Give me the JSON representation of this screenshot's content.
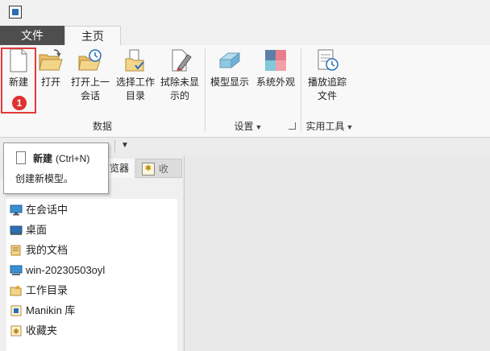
{
  "menu_tabs": [
    {
      "label": "文件",
      "active": false
    },
    {
      "label": "主页",
      "active": true
    }
  ],
  "ribbon": {
    "buttons": [
      {
        "name": "new",
        "label": "新建",
        "icon": "new-document-icon",
        "highlighted": true,
        "badge": "1"
      },
      {
        "name": "open",
        "label": "打开",
        "icon": "open-folder-icon"
      },
      {
        "name": "open-last-session",
        "label1": "打开上一",
        "label2": "会话",
        "icon": "last-session-icon"
      },
      {
        "name": "select-working-dir",
        "label1": "选择工作",
        "label2": "目录",
        "icon": "working-directory-icon"
      },
      {
        "name": "erase-not-displayed",
        "label1": "拭除未显",
        "label2": "示的",
        "icon": "erase-icon"
      },
      {
        "name": "model-display",
        "label": "模型显示",
        "icon": "model-display-icon"
      },
      {
        "name": "system-appearance",
        "label": "系统外观",
        "icon": "system-appearance-icon"
      },
      {
        "name": "play-trail-file",
        "label1": "播放追踪",
        "label2": "文件",
        "icon": "trail-file-icon"
      }
    ],
    "groups": [
      {
        "label": "数据"
      },
      {
        "label": "设置",
        "dropdown": true
      },
      {
        "label": "实用工具",
        "dropdown": true
      }
    ]
  },
  "panel_tabs": [
    {
      "label": "览器"
    },
    {
      "label": "收",
      "icon": "favorites-icon"
    }
  ],
  "tree_items": [
    {
      "label": "在会话中",
      "icon": "monitor-icon"
    },
    {
      "label": "桌面",
      "icon": "desktop-icon"
    },
    {
      "label": "我的文档",
      "icon": "documents-icon"
    },
    {
      "label": "win-20230503oyl",
      "icon": "computer-icon"
    },
    {
      "label": "工作目录",
      "icon": "working-directory-icon"
    },
    {
      "label": "Manikin 库",
      "icon": "library-icon"
    },
    {
      "label": "收藏夹",
      "icon": "favorites-icon"
    }
  ],
  "tooltip": {
    "title": "新建",
    "shortcut": "(Ctrl+N)",
    "description": "创建新模型。"
  },
  "colors": {
    "file_tab_bg": "#4e4e4e",
    "highlight_red": "#e43a3a"
  }
}
